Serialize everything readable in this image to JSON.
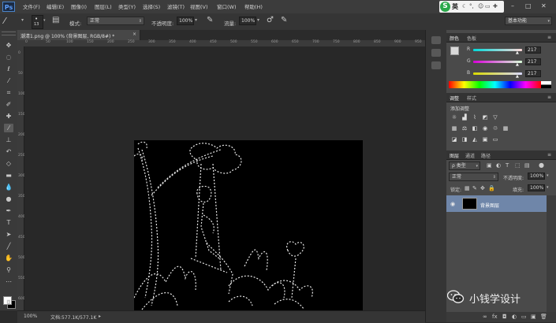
{
  "app": {
    "logo": "Ps"
  },
  "menu": [
    "文件(F)",
    "编辑(E)",
    "图像(I)",
    "图层(L)",
    "类型(Y)",
    "选择(S)",
    "滤镜(T)",
    "视图(V)",
    "窗口(W)",
    "帮助(H)"
  ],
  "ime": {
    "lang": "英"
  },
  "window_controls": {
    "minimize": "–",
    "restore": "□",
    "close": "✕"
  },
  "options": {
    "brush_size": "13",
    "mode_label": "模式:",
    "mode_value": "正常",
    "opacity_label": "不透明度:",
    "opacity_value": "100%",
    "flow_label": "流量:",
    "flow_value": "100%",
    "workspace": "基本功能"
  },
  "document": {
    "tab_title": "潮清1.png @ 100% (背景图层, RGB/8#) *",
    "zoom": "100%",
    "doc_size": "文档:577.1K/577.1K"
  },
  "ruler": {
    "top": [
      "0",
      "50",
      "100",
      "150",
      "200",
      "250",
      "300",
      "350",
      "400",
      "450",
      "500",
      "550",
      "600",
      "650",
      "700",
      "750",
      "800",
      "850",
      "900",
      "950"
    ],
    "left": [
      "0",
      "50",
      "100",
      "150",
      "200",
      "250",
      "300",
      "350",
      "400",
      "450",
      "500",
      "550",
      "600"
    ]
  },
  "color_panel": {
    "tabs": [
      "颜色",
      "色板"
    ],
    "r_label": "R",
    "r_value": "217",
    "g_label": "G",
    "g_value": "217",
    "b_label": "B",
    "b_value": "217"
  },
  "adjust_panel": {
    "tabs": [
      "调整",
      "样式"
    ],
    "title": "添加调整"
  },
  "layers_panel": {
    "tabs": [
      "图层",
      "通道",
      "路径"
    ],
    "filter_label": "ρ 类型",
    "blend_mode": "正常",
    "opacity_label": "不透明度:",
    "opacity_value": "100%",
    "lock_label": "锁定:",
    "fill_label": "填充:",
    "fill_value": "100%",
    "layer_name": "背景图层"
  },
  "watermark": {
    "text": "小钱学设计"
  },
  "colors": {
    "accent_layer": "#6f86a9",
    "ime_green": "#2aa84a"
  }
}
